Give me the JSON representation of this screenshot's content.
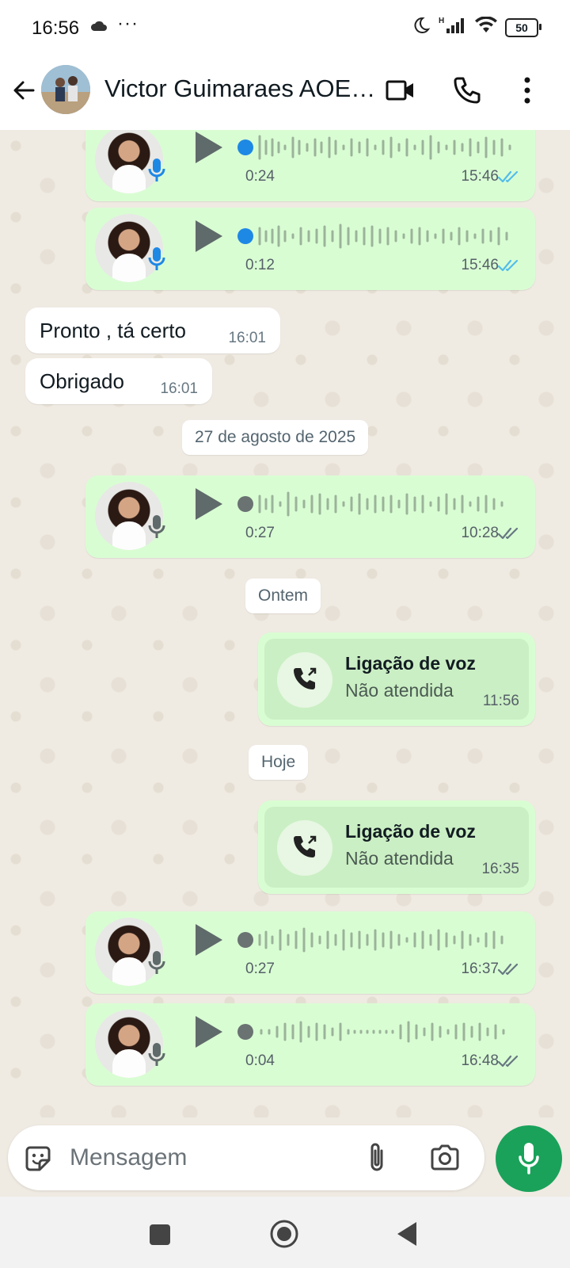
{
  "status_bar": {
    "time": "16:56",
    "battery": "50"
  },
  "header": {
    "contact_name": "Victor Guimaraes AOE…"
  },
  "messages": [
    {
      "duration": "0:24",
      "time": "15:46"
    },
    {
      "duration": "0:12",
      "time": "15:46"
    },
    {
      "text": "Pronto , tá certo",
      "time": "16:01"
    },
    {
      "text": "Obrigado",
      "time": "16:01"
    },
    {
      "date": "27 de agosto de 2025"
    },
    {
      "duration": "0:27",
      "time": "10:28"
    },
    {
      "date": "Ontem"
    },
    {
      "call_title": "Ligação de voz",
      "call_status": "Não atendida",
      "time": "11:56"
    },
    {
      "date": "Hoje"
    },
    {
      "call_title": "Ligação de voz",
      "call_status": "Não atendida",
      "time": "16:35"
    },
    {
      "duration": "0:27",
      "time": "16:37"
    },
    {
      "duration": "0:04",
      "time": "16:48"
    }
  ],
  "composer": {
    "placeholder": "Mensagem"
  },
  "colors": {
    "outgoing_bubble": "#d9fdd3",
    "read_ticks": "#53bdeb",
    "delivered_ticks": "#667781",
    "accent": "#1aa25a"
  }
}
